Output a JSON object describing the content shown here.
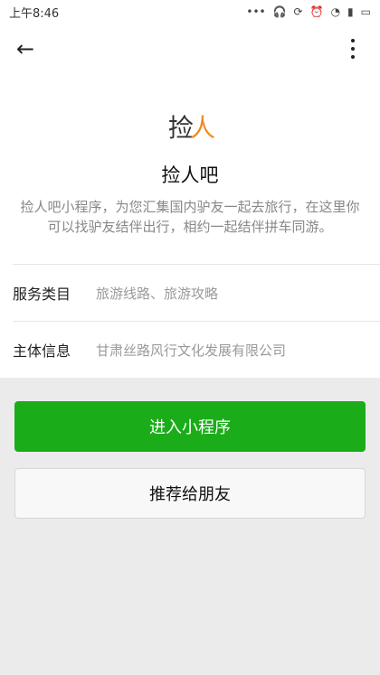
{
  "status_bar": {
    "time": "上午8:46",
    "icons": [
      "dots-icon",
      "headphones-icon",
      "sync-icon",
      "link-icon",
      "alarm-icon",
      "wifi-icon",
      "signal-icon",
      "battery-icon"
    ]
  },
  "appbar": {
    "back_icon": "arrow-left-icon",
    "more_icon": "more-vertical-icon"
  },
  "miniprogram": {
    "logo_text": "捡",
    "logo_accent": "人",
    "name": "捡人吧",
    "description": "捡人吧小程序，为您汇集国内驴友一起去旅行，在这里你可以找驴友结伴出行，相约一起结伴拼车同游。"
  },
  "info": {
    "rows": [
      {
        "label": "服务类目",
        "value": "旅游线路、旅游攻略"
      },
      {
        "label": "主体信息",
        "value": "甘肃丝路风行文化发展有限公司"
      }
    ]
  },
  "actions": {
    "enter_label": "进入小程序",
    "share_label": "推荐给朋友"
  }
}
